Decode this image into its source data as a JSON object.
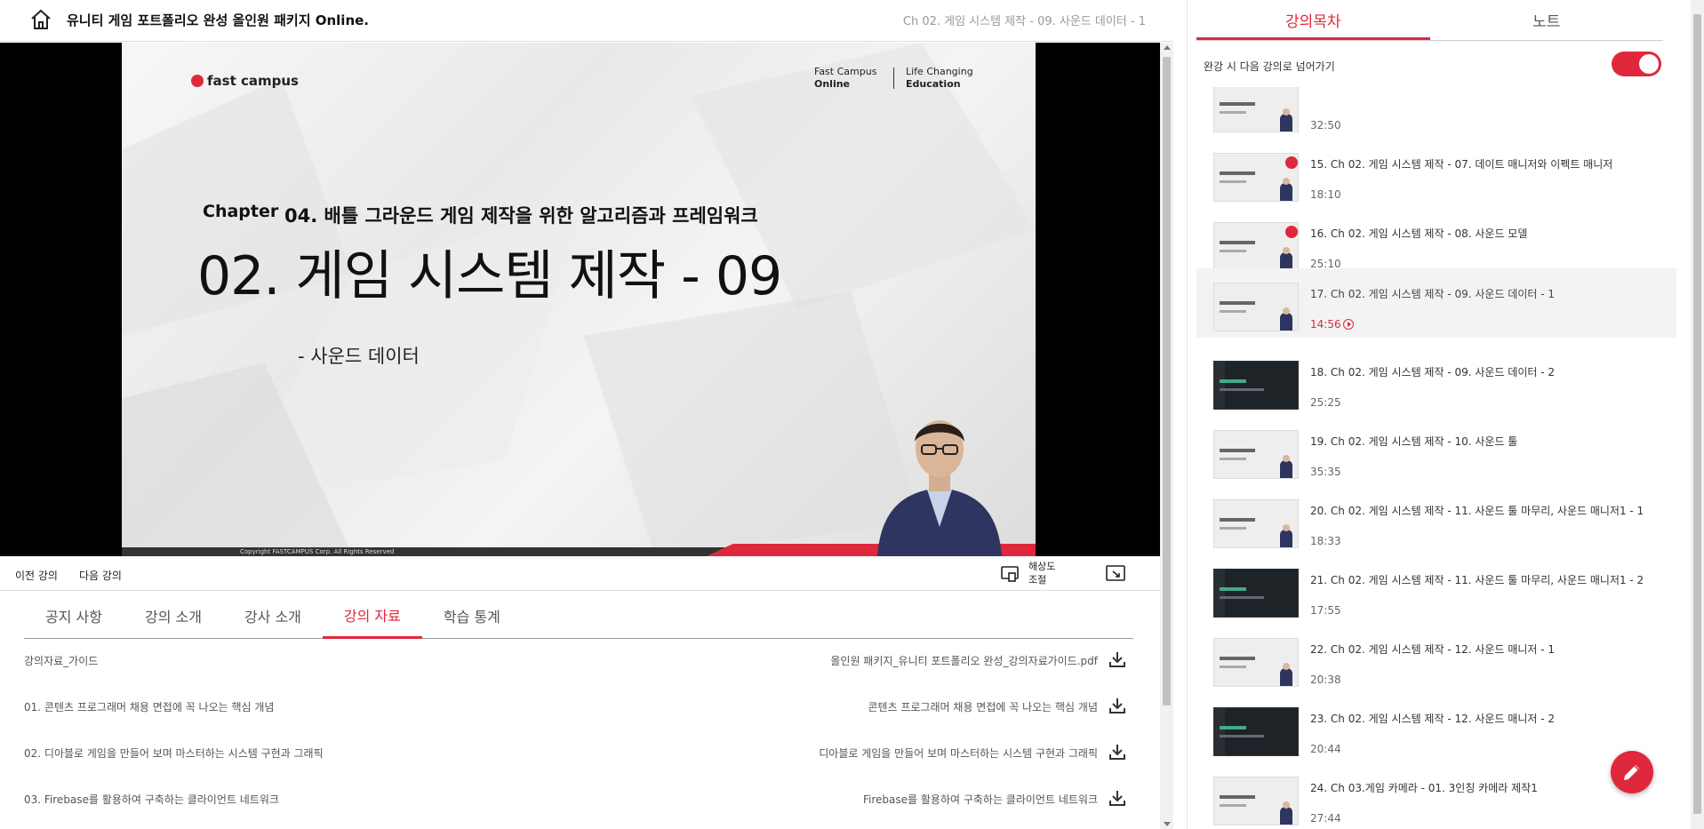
{
  "header": {
    "course_title": "유니티 게임 포트폴리오 완성 올인원 패키지 Online.",
    "current_lecture": "Ch 02. 게임 시스템 제작 - 09. 사운드 데이터 - 1"
  },
  "slide": {
    "logo_text": "fast campus",
    "online_line1": "Fast Campus",
    "online_line2": "Online",
    "life_line1": "Life Changing",
    "life_line2": "Education",
    "chapter_label": "Chapter",
    "chapter_sub": "04. 배틀 그라운드 게임 제작을 위한 알고리즘과 프레임워크",
    "title": "02. 게임 시스템 제작 - 09",
    "bullet": "- 사운드 데이터",
    "copyright": "Copyright FASTCAMPUS Corp. All Rights Reserved"
  },
  "player": {
    "progress_fraction": 0.012
  },
  "controls": {
    "prev": "이전 강의",
    "next": "다음 강의",
    "resolution_line1": "해상도",
    "resolution_line2": "조절"
  },
  "tabs": [
    {
      "label": "공지 사항"
    },
    {
      "label": "강의 소개"
    },
    {
      "label": "강사 소개"
    },
    {
      "label": "강의 자료"
    },
    {
      "label": "학습 통계"
    }
  ],
  "materials": [
    {
      "name": "강의자료_가이드",
      "file": "올인원 패키지_유니티 포트폴리오 완성_강의자료가이드.pdf"
    },
    {
      "name": "01. 콘텐츠 프로그래머 채용 면접에 꼭 나오는 핵심 개념",
      "file": "콘텐츠 프로그래머 채용 면접에 꼭 나오는 핵심 개념"
    },
    {
      "name": "02. 디아블로 게임을 만들어 보며 마스터하는 시스템 구현과 그래픽",
      "file": "디아블로 게임을 만들어 보며 마스터하는 시스템 구현과 그래픽"
    },
    {
      "name": "03. Firebase를 활용하여 구축하는 클라이언트 네트워크",
      "file": "Firebase를 활용하여 구축하는 클라이언트 네트워크"
    }
  ],
  "sidebar": {
    "tab_toc": "강의목차",
    "tab_notes": "노트",
    "autoplay_label": "완강 시 다음 강의로 넘어가기",
    "autoplay_on": true,
    "lectures": [
      {
        "title": "",
        "duration": "32:50"
      },
      {
        "title": "15. Ch 02. 게임 시스템 제작 - 07. 데이트 매니저와 이펙트 매니저",
        "duration": "18:10"
      },
      {
        "title": "16. Ch 02. 게임 시스템 제작 - 08. 사운드 모델",
        "duration": "25:10"
      },
      {
        "title": "17. Ch 02. 게임 시스템 제작 - 09. 사운드 데이터 - 1",
        "duration": "14:56"
      },
      {
        "title": "18. Ch 02. 게임 시스템 제작 - 09. 사운드 데이터 - 2",
        "duration": "25:25"
      },
      {
        "title": "19. Ch 02. 게임 시스템 제작 - 10. 사운드 툴",
        "duration": "35:35"
      },
      {
        "title": "20. Ch 02. 게임 시스템 제작 - 11. 사운드 툴 마무리, 사운드 매니저1 - 1",
        "duration": "18:33"
      },
      {
        "title": "21. Ch 02. 게임 시스템 제작 - 11. 사운드 툴 마무리, 사운드 매니저1 - 2",
        "duration": "17:55"
      },
      {
        "title": "22. Ch 02. 게임 시스템 제작 - 12. 사운드 매니저 - 1",
        "duration": "20:38"
      },
      {
        "title": "23. Ch 02. 게임 시스템 제작 - 12. 사운드 매니저 - 2",
        "duration": "20:44"
      },
      {
        "title": "24. Ch 03.게임 카메라 - 01. 3인칭 카메라 제작1",
        "duration": "27:44"
      }
    ]
  },
  "colors": {
    "accent": "#e0283c"
  }
}
